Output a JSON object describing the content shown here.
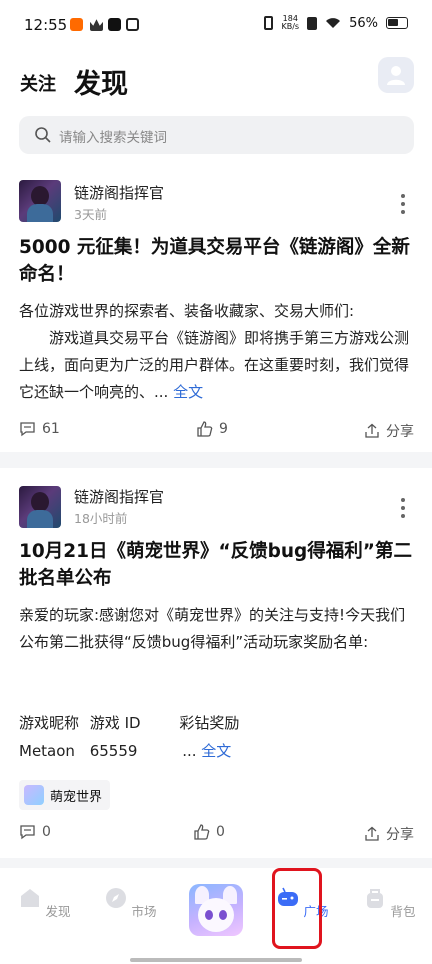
{
  "status_bar": {
    "time": "12:55",
    "net_speed_value": "184",
    "net_speed_unit": "KB/s",
    "battery": "56%"
  },
  "header": {
    "tab_follow": "关注",
    "tab_discover": "发现"
  },
  "search": {
    "placeholder": "请输入搜索关键词"
  },
  "posts": [
    {
      "author": "链游阁指挥官",
      "time": "3天前",
      "title": "5000 元征集！为道具交易平台《链游阁》全新命名！",
      "body_lines": [
        "各位游戏世界的探索者、装备收藏家、交易大师们:",
        "　　游戏道具交易平台《链游阁》即将携手第三方游戏公测上线，面向更为广泛的用户群体。在这重要时刻，我们觉得它还缺一个响亮的、... "
      ],
      "read_more": "全文",
      "comments": "61",
      "likes": "9",
      "share": "分享"
    },
    {
      "author": "链游阁指挥官",
      "time": "18小时前",
      "title": "10月21日《萌宠世界》“反馈bug得福利”第二批名单公布",
      "body": "亲爱的玩家:感谢您对《萌宠世界》的关注与支持!今天我们公布第二批获得“反馈bug得福利”活动玩家奖励名单:",
      "table_header": [
        "游戏昵称",
        "游戏 ID",
        "彩钻奖励"
      ],
      "table_row": [
        "Metaon",
        "65559",
        "... "
      ],
      "read_more": "全文",
      "tag": "萌宠世界",
      "comments": "0",
      "likes": "0",
      "share": "分享"
    }
  ],
  "bottom_nav": {
    "items": [
      "发现",
      "市场",
      "广场",
      "背包"
    ],
    "active": "广场",
    "accent_color": "#3b6cf6",
    "highlight_color": "#e0141e"
  }
}
